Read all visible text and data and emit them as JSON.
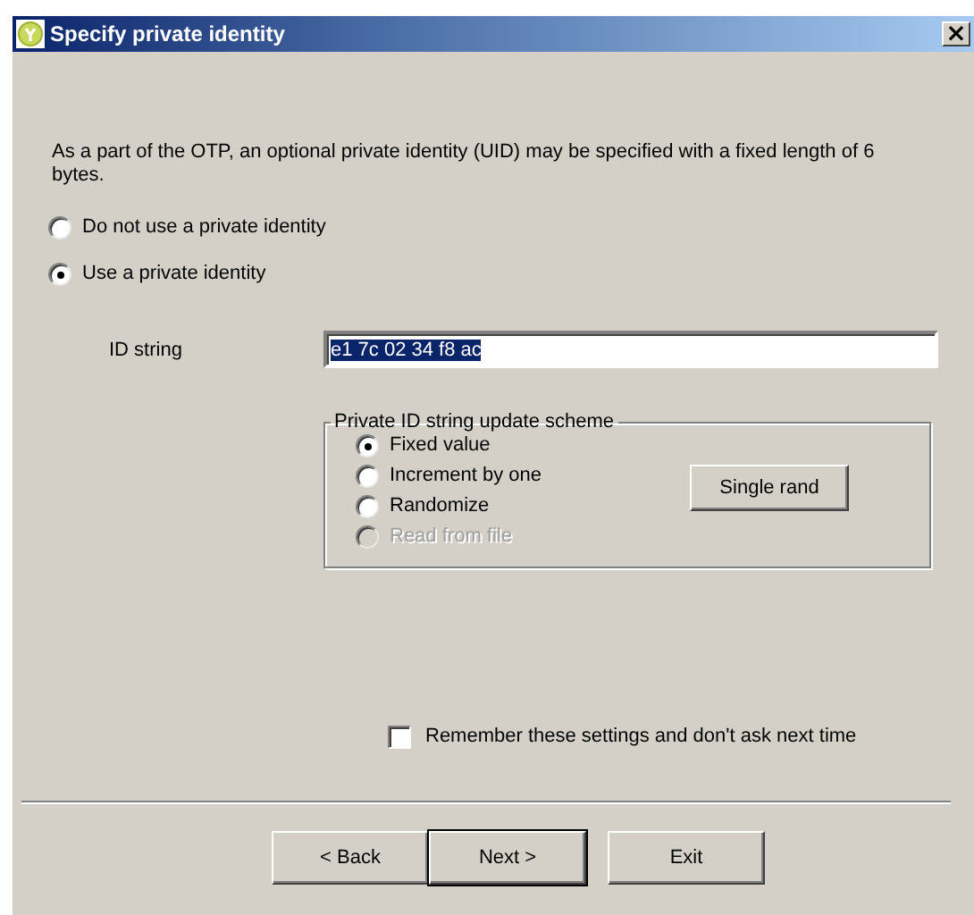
{
  "window": {
    "title": "Specify private identity",
    "close": "×"
  },
  "description": "As a part of the OTP, an optional private identity (UID) may be specified with a fixed length of 6 bytes.",
  "identity_options": [
    {
      "label": "Do not use a private identity",
      "selected": false
    },
    {
      "label": "Use a private identity",
      "selected": true
    }
  ],
  "id_string": {
    "label": "ID string",
    "value": "e1 7c 02 34 f8 ac",
    "value_selected": true
  },
  "update_scheme": {
    "legend": "Private ID string update scheme",
    "options": [
      {
        "label": "Fixed value",
        "selected": true,
        "disabled": false
      },
      {
        "label": "Increment by one",
        "selected": false,
        "disabled": false
      },
      {
        "label": "Randomize",
        "selected": false,
        "disabled": false
      },
      {
        "label": "Read from file",
        "selected": false,
        "disabled": true
      }
    ],
    "button": "Single rand"
  },
  "remember": {
    "label": "Remember these settings and don't ask next time",
    "checked": false
  },
  "buttons": [
    {
      "label": "< Back",
      "default": false
    },
    {
      "label": "Next >",
      "default": true
    },
    {
      "label": "Exit",
      "default": false
    }
  ]
}
